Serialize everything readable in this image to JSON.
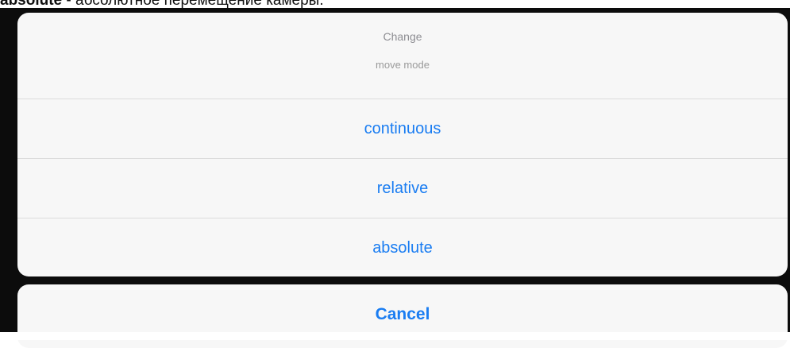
{
  "document_text": {
    "bold": "absolute",
    "rest": " - абсолютное перемещение камеры."
  },
  "action_sheet": {
    "title": "Change",
    "message": "move mode",
    "options": [
      {
        "label": "continuous"
      },
      {
        "label": "relative"
      },
      {
        "label": "absolute"
      }
    ],
    "cancel_label": "Cancel"
  },
  "colors": {
    "accent": "#1a7df2",
    "backdrop": "#0c0c0c",
    "sheet_background": "#f7f7f7"
  }
}
